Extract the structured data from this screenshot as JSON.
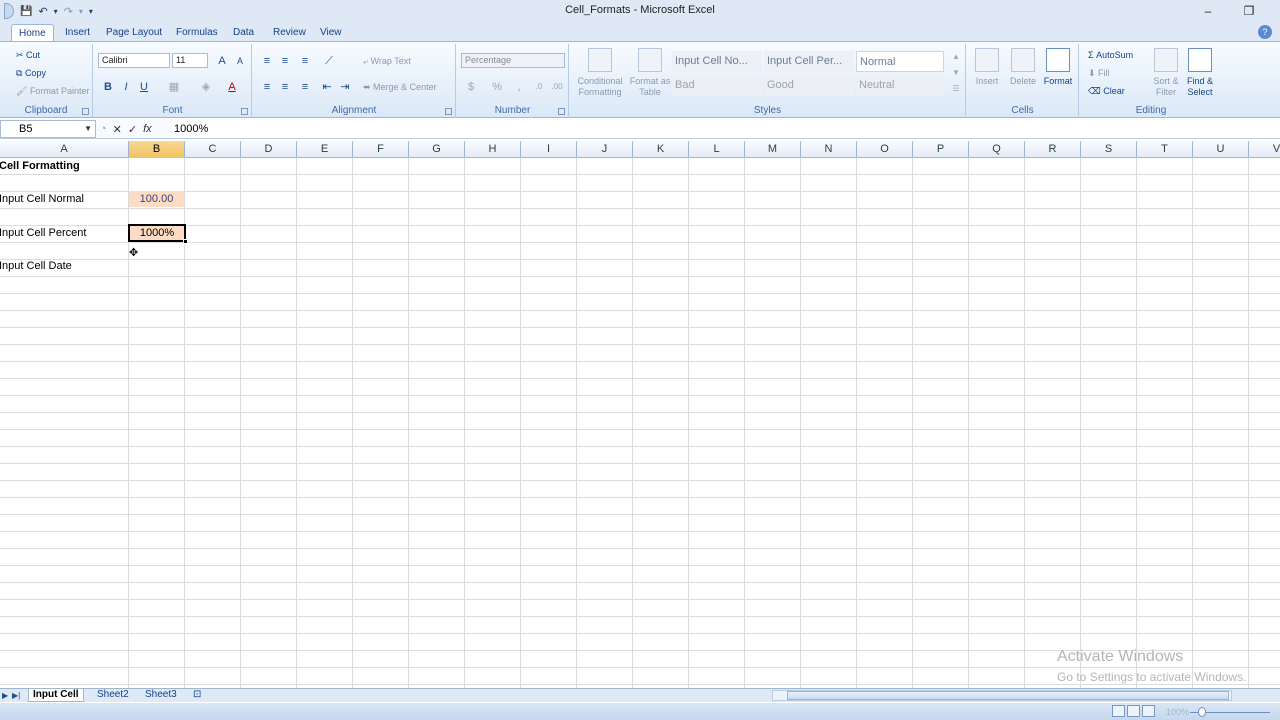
{
  "window": {
    "title": "Cell_Formats - Microsoft Excel",
    "minimize": "–",
    "restore": "❐"
  },
  "qat": {
    "save": "💾",
    "undo": "↶",
    "redo": "↷",
    "customize": "▾"
  },
  "tabs": [
    "Home",
    "Insert",
    "Page Layout",
    "Formulas",
    "Data",
    "Review",
    "View"
  ],
  "ribbon": {
    "clipboard": {
      "cut": "Cut",
      "copy": "Copy",
      "format_painter": "Format Painter",
      "label": "Clipboard"
    },
    "font": {
      "name": "Calibri",
      "size": "11",
      "bold": "B",
      "italic": "I",
      "underline": "U",
      "label": "Font"
    },
    "alignment": {
      "wrap_text": "Wrap Text",
      "merge_center": "Merge & Center",
      "label": "Alignment"
    },
    "number": {
      "format": "Percentage",
      "dollar": "$",
      "percent": "%",
      "label": "Number"
    },
    "styles": {
      "conditional": "Conditional\nFormatting",
      "format_table": "Format as\nTable",
      "cells": [
        "Input Cell No...",
        "Input Cell Per...",
        "Normal",
        "Bad",
        "Good",
        "Neutral"
      ],
      "label": "Styles"
    },
    "cells_group": {
      "insert": "Insert",
      "delete": "Delete",
      "format": "Format",
      "label": "Cells"
    },
    "editing": {
      "autosum": "AutoSum",
      "fill": "Fill",
      "clear": "Clear",
      "sort": "Sort &\nFilter",
      "find": "Find &\nSelect",
      "label": "Editing"
    }
  },
  "formula_bar": {
    "name_box": "B5",
    "value": "1000%"
  },
  "columns": [
    "A",
    "B",
    "C",
    "D",
    "E",
    "F",
    "G",
    "H",
    "I",
    "J",
    "K",
    "L",
    "M",
    "N",
    "O",
    "P",
    "Q",
    "R",
    "S",
    "T",
    "U",
    "V"
  ],
  "sheet": {
    "title": "Cell Formatting",
    "label_normal": "Input Cell Normal",
    "value_normal": "100.00",
    "label_percent": "Input Cell Percent",
    "value_percent": "1000%",
    "label_date": "Input Cell Date"
  },
  "watermark": {
    "line1": "Activate Windows",
    "line2": "Go to Settings to activate Windows."
  },
  "sheet_tabs": [
    "Input Cell",
    "Sheet2",
    "Sheet3"
  ],
  "status": {
    "zoom": "100%"
  }
}
